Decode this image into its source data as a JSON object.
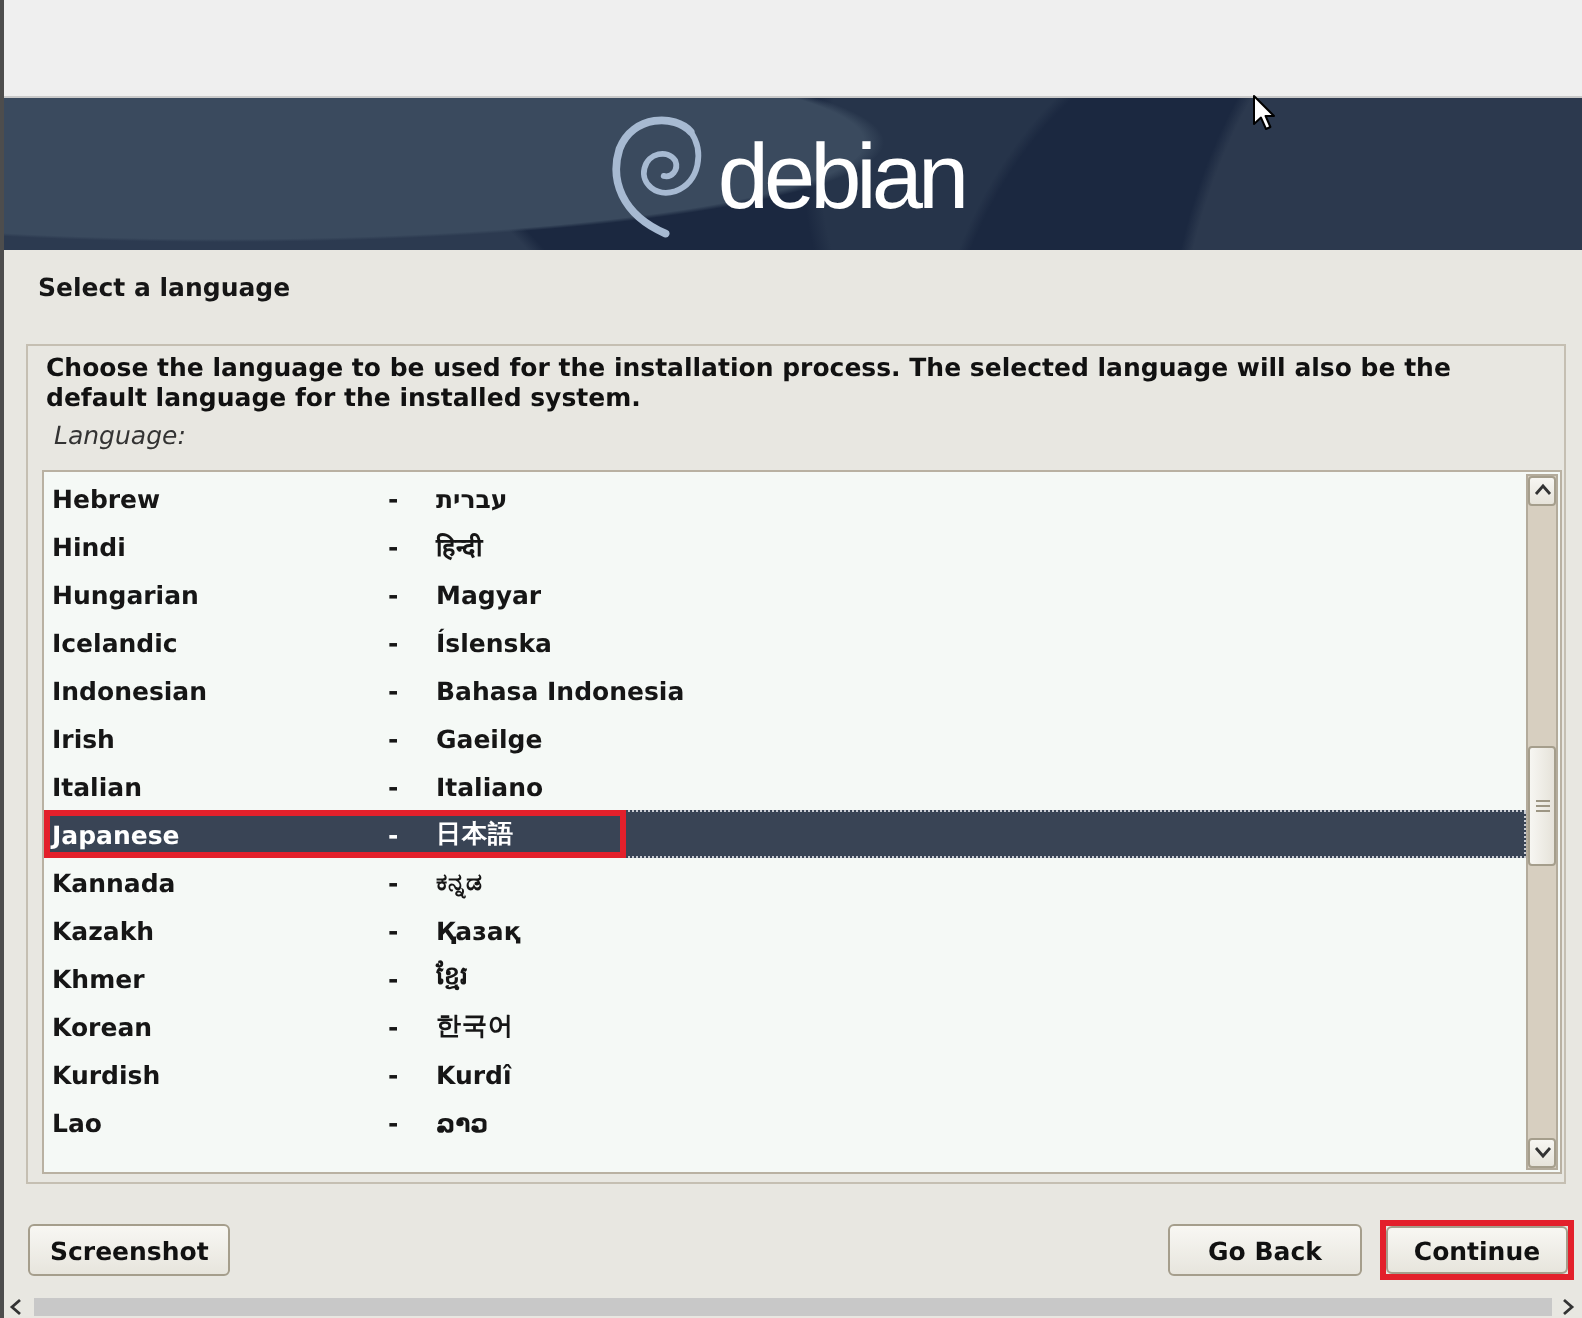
{
  "banner": {
    "logo_text": "debian"
  },
  "title": "Select a language",
  "panel": {
    "instructions": "Choose the language to be used for the installation process. The selected language will also be the default language for the installed system.",
    "list_label": "Language:"
  },
  "languages": [
    {
      "name": "Hebrew",
      "separator": "-",
      "native": "עברית",
      "selected": false,
      "highlighted": false
    },
    {
      "name": "Hindi",
      "separator": "-",
      "native": "हिन्दी",
      "selected": false,
      "highlighted": false
    },
    {
      "name": "Hungarian",
      "separator": "-",
      "native": "Magyar",
      "selected": false,
      "highlighted": false
    },
    {
      "name": "Icelandic",
      "separator": "-",
      "native": "Íslenska",
      "selected": false,
      "highlighted": false
    },
    {
      "name": "Indonesian",
      "separator": "-",
      "native": "Bahasa Indonesia",
      "selected": false,
      "highlighted": false
    },
    {
      "name": "Irish",
      "separator": "-",
      "native": "Gaeilge",
      "selected": false,
      "highlighted": false
    },
    {
      "name": "Italian",
      "separator": "-",
      "native": "Italiano",
      "selected": false,
      "highlighted": false
    },
    {
      "name": "Japanese",
      "separator": "-",
      "native": "日本語",
      "selected": true,
      "highlighted": true
    },
    {
      "name": "Kannada",
      "separator": "-",
      "native": "ಕನ್ನಡ",
      "selected": false,
      "highlighted": false
    },
    {
      "name": "Kazakh",
      "separator": "-",
      "native": "Қазақ",
      "selected": false,
      "highlighted": false
    },
    {
      "name": "Khmer",
      "separator": "-",
      "native": "ខ្មែរ",
      "selected": false,
      "highlighted": false
    },
    {
      "name": "Korean",
      "separator": "-",
      "native": "한국어",
      "selected": false,
      "highlighted": false
    },
    {
      "name": "Kurdish",
      "separator": "-",
      "native": "Kurdî",
      "selected": false,
      "highlighted": false
    },
    {
      "name": "Lao",
      "separator": "-",
      "native": "ລາວ",
      "selected": false,
      "highlighted": false
    }
  ],
  "footer": {
    "left_buttons": [
      {
        "label": "Screenshot",
        "highlighted": false
      }
    ],
    "right_buttons": [
      {
        "label": "Go Back",
        "highlighted": false
      },
      {
        "label": "Continue",
        "highlighted": true
      }
    ]
  }
}
